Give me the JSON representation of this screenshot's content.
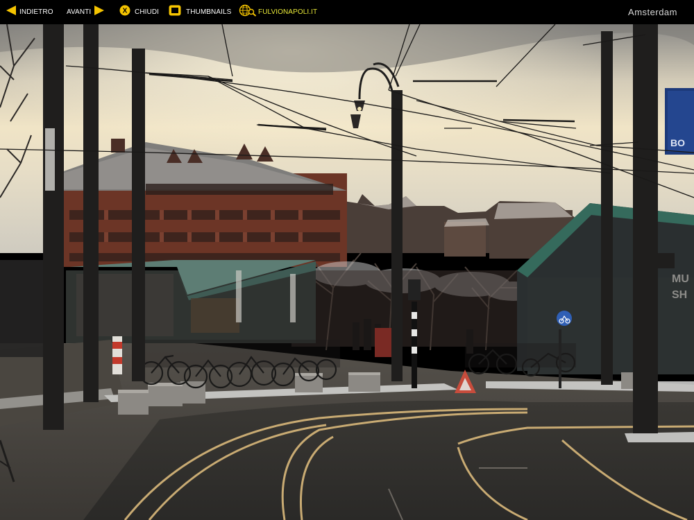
{
  "toolbar": {
    "prev_label": "INDIETRO",
    "next_label": "AVANTI",
    "close_label": "CHIUDI",
    "close_icon_glyph": "X",
    "thumbnails_label": "THUMBNAILS",
    "site_label": "FULVIONAPOLI.IT",
    "icons": [
      "arrow-left-icon",
      "arrow-right-icon",
      "close-icon",
      "thumbnails-icon",
      "globe-search-icon"
    ],
    "accent_color": "#f5c400",
    "site_color": "#e8e838"
  },
  "gallery": {
    "title": "Amsterdam"
  },
  "photo": {
    "sign_text_1": "MU",
    "sign_text_2": "SH",
    "blue_sign_text": "BO"
  }
}
